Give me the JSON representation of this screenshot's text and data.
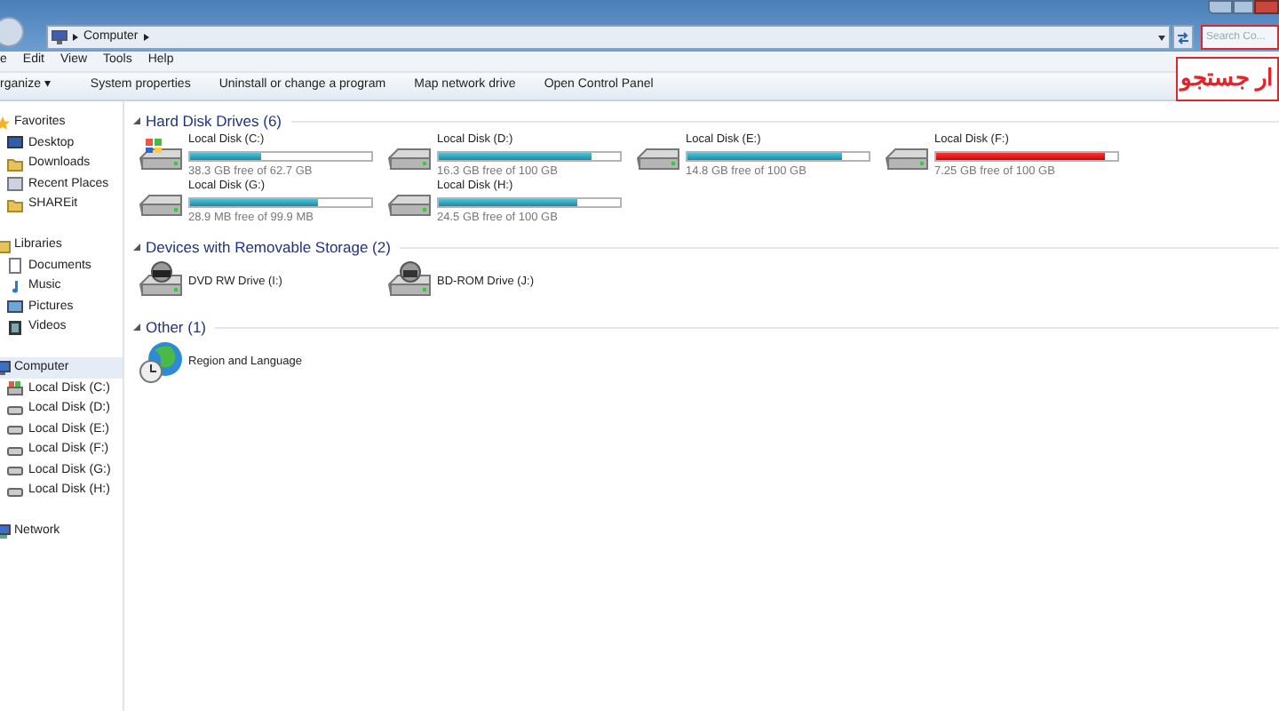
{
  "address_bar": {
    "path": "Computer"
  },
  "search": {
    "placeholder": "Search Co..."
  },
  "annotation": {
    "text": "ار جستجو"
  },
  "menu": [
    "e",
    "Edit",
    "View",
    "Tools",
    "Help"
  ],
  "command_bar": [
    "rganize ▾",
    "System properties",
    "Uninstall or change a program",
    "Map network drive",
    "Open Control Panel"
  ],
  "sidebar": {
    "groups": [
      {
        "label": "Favorites",
        "kind": "favorites",
        "selected": false,
        "items": [
          {
            "label": "Desktop",
            "kind": "desktop"
          },
          {
            "label": "Downloads",
            "kind": "folder"
          },
          {
            "label": "Recent Places",
            "kind": "recent"
          },
          {
            "label": "SHAREit",
            "kind": "folder"
          }
        ]
      },
      {
        "label": "Libraries",
        "kind": "libraries",
        "selected": false,
        "items": [
          {
            "label": "Documents",
            "kind": "document"
          },
          {
            "label": "Music",
            "kind": "music"
          },
          {
            "label": "Pictures",
            "kind": "picture"
          },
          {
            "label": "Videos",
            "kind": "video"
          }
        ]
      },
      {
        "label": "Computer",
        "kind": "computer",
        "selected": true,
        "items": [
          {
            "label": "Local Disk (C:)",
            "kind": "system"
          },
          {
            "label": "Local Disk (D:)",
            "kind": "disk"
          },
          {
            "label": "Local Disk (E:)",
            "kind": "disk"
          },
          {
            "label": "Local Disk (F:)",
            "kind": "disk"
          },
          {
            "label": "Local Disk (G:)",
            "kind": "disk"
          },
          {
            "label": "Local Disk (H:)",
            "kind": "disk"
          }
        ]
      },
      {
        "label": "Network",
        "kind": "network",
        "selected": false
      }
    ]
  },
  "sections": [
    {
      "title": "Hard Disk Drives (6)",
      "items": [
        {
          "kind": "system",
          "name": "Local Disk (C:)",
          "level": 0.39,
          "low_space": false,
          "free": "38.3 GB free of 62.7 GB"
        },
        {
          "kind": "disk",
          "name": "Local Disk (D:)",
          "level": 0.84,
          "low_space": false,
          "free": "16.3 GB free of 100 GB"
        },
        {
          "kind": "disk",
          "name": "Local Disk (E:)",
          "level": 0.85,
          "low_space": false,
          "free": "14.8 GB free of 100 GB"
        },
        {
          "kind": "disk",
          "name": "Local Disk (F:)",
          "level": 0.93,
          "low_space": true,
          "free": "7.25 GB free of 100 GB"
        },
        {
          "kind": "disk",
          "name": "Local Disk (G:)",
          "level": 0.71,
          "low_space": false,
          "free": "28.9 MB free of 99.9 MB"
        },
        {
          "kind": "disk",
          "name": "Local Disk (H:)",
          "level": 0.76,
          "low_space": false,
          "free": "24.5 GB free of 100 GB"
        }
      ]
    },
    {
      "title": "Devices with Removable Storage (2)",
      "items": [
        {
          "kind": "dvd",
          "name": "DVD RW Drive (I:)"
        },
        {
          "kind": "bd",
          "name": "BD-ROM Drive (J:)"
        }
      ]
    },
    {
      "title": "Other (1)",
      "items": [
        {
          "kind": "globe",
          "name": "Region and Language"
        }
      ]
    }
  ]
}
